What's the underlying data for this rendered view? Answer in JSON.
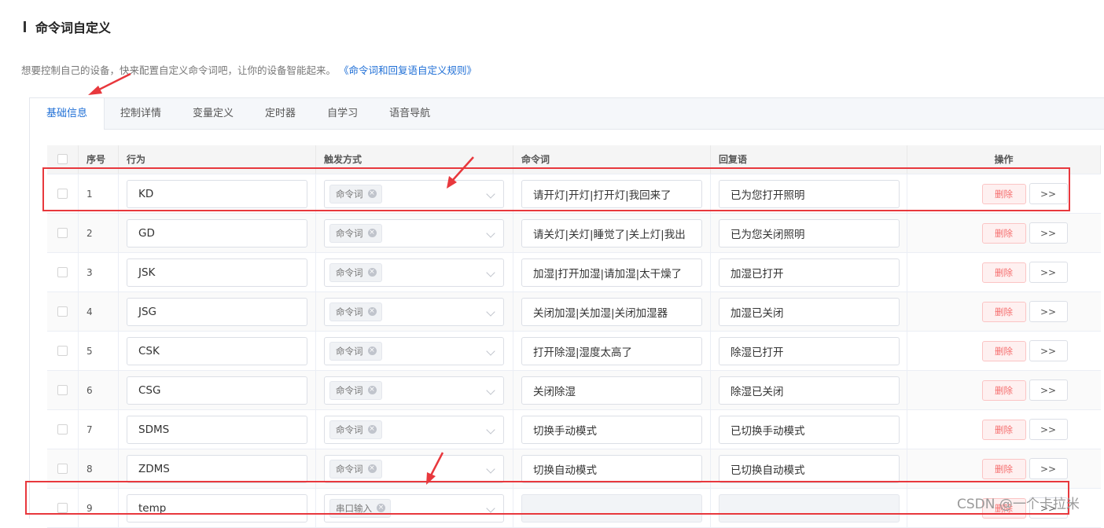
{
  "header": {
    "title": "命令词自定义"
  },
  "intro": {
    "text": "想要控制自己的设备，快来配置自定义命令词吧，让你的设备智能起来。",
    "link": "《命令词和回复语自定义规则》"
  },
  "tabs": [
    {
      "label": "基础信息",
      "active": true
    },
    {
      "label": "控制详情"
    },
    {
      "label": "变量定义"
    },
    {
      "label": "定时器"
    },
    {
      "label": "自学习"
    },
    {
      "label": "语音导航"
    }
  ],
  "table": {
    "headers": {
      "no": "序号",
      "action": "行为",
      "trigger": "触发方式",
      "command": "命令词",
      "reply": "回复语",
      "op": "操作"
    },
    "delete_label": "删除",
    "more_label": ">>",
    "rows": [
      {
        "no": "1",
        "action": "KD",
        "trigger": "命令词",
        "command": "请开灯|开灯|打开灯|我回来了",
        "reply": "已为您打开照明"
      },
      {
        "no": "2",
        "action": "GD",
        "trigger": "命令词",
        "command": "请关灯|关灯|睡觉了|关上灯|我出",
        "reply": "已为您关闭照明"
      },
      {
        "no": "3",
        "action": "JSK",
        "trigger": "命令词",
        "command": "加湿|打开加湿|请加湿|太干燥了",
        "reply": "加湿已打开"
      },
      {
        "no": "4",
        "action": "JSG",
        "trigger": "命令词",
        "command": "关闭加湿|关加湿|关闭加湿器",
        "reply": "加湿已关闭"
      },
      {
        "no": "5",
        "action": "CSK",
        "trigger": "命令词",
        "command": "打开除湿|湿度太高了",
        "reply": "除湿已打开"
      },
      {
        "no": "6",
        "action": "CSG",
        "trigger": "命令词",
        "command": "关闭除湿",
        "reply": "除湿已关闭"
      },
      {
        "no": "7",
        "action": "SDMS",
        "trigger": "命令词",
        "command": "切换手动模式",
        "reply": "已切换手动模式"
      },
      {
        "no": "8",
        "action": "ZDMS",
        "trigger": "命令词",
        "command": "切换自动模式",
        "reply": "已切换自动模式"
      },
      {
        "no": "9",
        "action": "temp",
        "trigger": "串口输入",
        "command": "",
        "reply": ""
      }
    ]
  },
  "watermark": "CSDN @一个卡拉米",
  "colors": {
    "highlight": "#e8383d",
    "link": "#1f6fd6",
    "danger": "#f56c6c"
  }
}
